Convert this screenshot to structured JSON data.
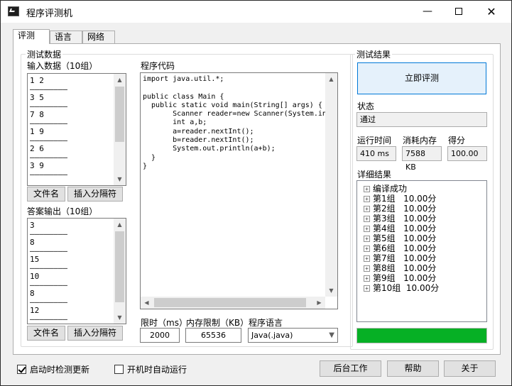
{
  "window": {
    "title": "程序评测机",
    "minimize": "—",
    "close": "✕"
  },
  "tabs": [
    "评测",
    "语言",
    "网络"
  ],
  "test_data": {
    "group_title": "测试数据",
    "input_label": "输入数据（10组）",
    "input_items": [
      "1 2",
      "3 5",
      "7 8",
      "1 9",
      "2 6",
      "3 9"
    ],
    "separator": "————————",
    "answer_label": "答案输出（10组）",
    "answer_items": [
      "3",
      "8",
      "15",
      "10",
      "8",
      "12"
    ],
    "filename_button": "文件名",
    "insert_sep_button": "插入分隔符"
  },
  "code": {
    "label": "程序代码",
    "text": "import java.util.*;\n\npublic class Main {\n  public static void main(String[] args) {\n       Scanner reader=new Scanner(System.in);\n       int a,b;\n       a=reader.nextInt();\n       b=reader.nextInt();\n       System.out.println(a+b);\n  }\n}"
  },
  "limits": {
    "time_label": "限时（ms）",
    "time_value": "2000",
    "memory_label": "内存限制（KB）",
    "memory_value": "65536",
    "language_label": "程序语言",
    "language_value": "Java(.java)"
  },
  "results": {
    "group_title": "测试结果",
    "run_button": "立即评测",
    "status_label": "状态",
    "status_value": "通过",
    "time_label": "运行时间",
    "time_value": "410 ms",
    "memory_label": "消耗内存",
    "memory_value": "7588 KB",
    "score_label": "得分",
    "score_value": "100.00",
    "detail_label": "详细结果",
    "detail_items": [
      "编译成功",
      "第1组   10.00分",
      "第2组   10.00分",
      "第3组   10.00分",
      "第4组   10.00分",
      "第5组   10.00分",
      "第6组   10.00分",
      "第7组   10.00分",
      "第8组   10.00分",
      "第9组   10.00分",
      "第10组  10.00分"
    ],
    "progress": 1.0,
    "progress_color": "#06b025"
  },
  "footer": {
    "check_update": {
      "label": "启动时检测更新",
      "checked": true
    },
    "auto_run": {
      "label": "开机时自动运行",
      "checked": false
    },
    "background_button": "后台工作",
    "help_button": "帮助",
    "about_button": "关于"
  }
}
